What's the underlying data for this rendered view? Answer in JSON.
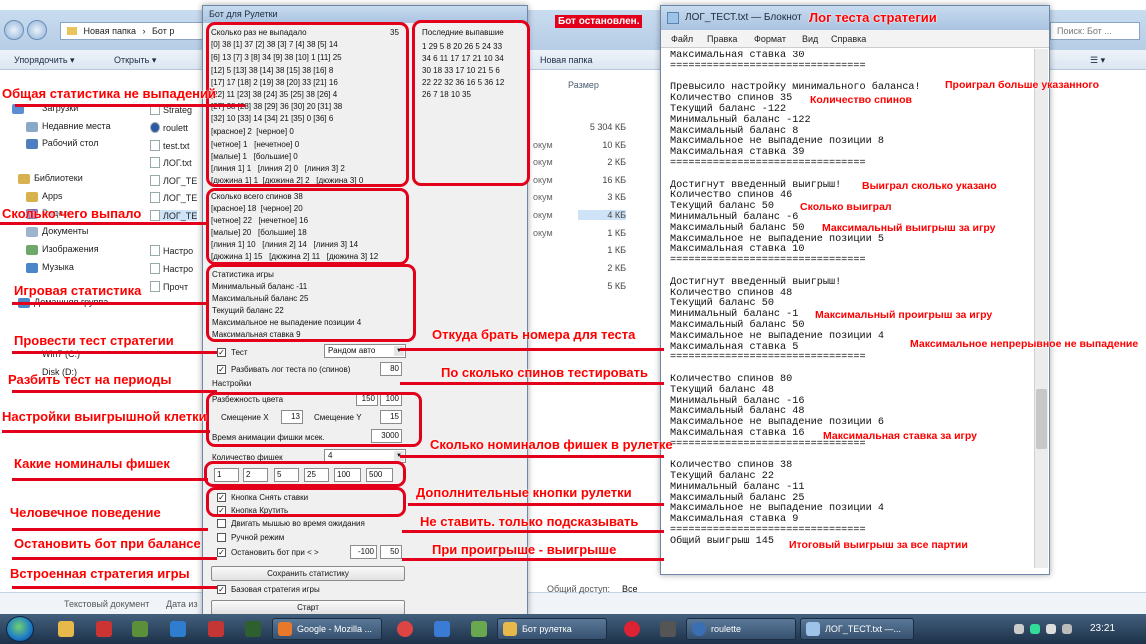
{
  "explorer": {
    "address": [
      "Новая папка",
      "Бот р"
    ],
    "search_placeholder": "Поиск: Бот ...",
    "toolbar": {
      "organize": "Упорядочить ▾",
      "open": "Открыть ▾",
      "new_folder": "Новая папка"
    },
    "size_header": "Размер",
    "sidebar": [
      "Загрузки",
      "Недавние места",
      "Рабочий стол",
      "Библиотеки",
      "Apps",
      "Видео",
      "Документы",
      "Изображения",
      "Музыка",
      "Домашняя группа",
      "Win7 (C:)",
      "Disk (D:)"
    ],
    "files": [
      "Strateg",
      "roulett",
      "test.txt",
      "ЛОГ.txt",
      "ЛОГ_ТЕ",
      "ЛОГ_ТЕ",
      "ЛОГ_ТЕ",
      "Настро",
      "Настро",
      "Прочт"
    ],
    "file_kinds": [
      "",
      "",
      "окум",
      "окум",
      "окум",
      "окум",
      "окум",
      "окум",
      "",
      ""
    ],
    "sizes": [
      "5 304 КБ",
      "10 КБ",
      "2 КБ",
      "16 КБ",
      "3 КБ",
      "4 КБ",
      "1 КБ",
      "1 КБ",
      "2 КБ",
      "5 КБ"
    ],
    "status_doc": "Текстовый документ",
    "status_date": "Дата из",
    "status_access": "Общий доступ:",
    "status_access_value": "Все"
  },
  "bot": {
    "title": "Бот для Рулетки",
    "never_header": "Сколько раз не выпадало",
    "never_max": "35",
    "never_lines": [
      "[0] 38 [1] 37 [2] 38 [3] 7 [4] 38 [5] 14",
      "[6] 13 [7] 3 [8] 34 [9] 38 [10] 1 [11] 25",
      "[12] 5 [13] 38 [14] 38 [15] 38 [16] 8",
      "[17] 17 [18] 2 [19] 38 [20] 33 [21] 16",
      "[22] 11 [23] 38 [24] 35 [25] 38 [26] 4",
      "[27] 38 [28] 38 [29] 36 [30] 20 [31] 38",
      "[32] 10 [33] 14 [34] 21 [35] 0 [36] 6",
      "[красное] 2  [черное] 0",
      "[четное] 1   [нечетное] 0",
      "[малые] 1   [большие] 0",
      "[линия 1] 1   [линия 2] 0   [линия 3] 2",
      "[дюжина 1] 1  [дюжина 2] 2   [дюжина 3] 0"
    ],
    "last_header": "Последние выпавшие",
    "last_lines": [
      "1 29 5 8 20 26 5 24 33",
      "34 6 11 17 17 21 10 34",
      "30 18 33 17 10 21 5 6",
      "22 22 32 36 16 5 36 12",
      "26 7 18 10 35"
    ],
    "total_header": "Сколько всего спинов 38",
    "total_lines": [
      "[красное] 18  [черное] 20",
      "[четное] 22   [нечетное] 16",
      "[малые] 20   [большие] 18",
      "[линия 1] 10   [линия 2] 14   [линия 3] 14",
      "[дюжина 1] 15   [дюжина 2] 11   [дюжина 3] 12"
    ],
    "game_stats_lines": [
      "Статистика игры",
      "Минимальный баланс -11",
      "Максимальный баланс 25",
      "Текущий баланс 22",
      "Максимальное не выпадение позиции 4",
      "Максимальная ставка 9"
    ],
    "test_label": "Тест",
    "test_source": "Рандом авто",
    "split_label": "Разбивать лог теста по (спинов)",
    "split_value": "80",
    "settings_label": "Настройки",
    "color_spread_label": "Разбежность цвета",
    "color_spread_values": [
      "150",
      "100"
    ],
    "offset_x_label": "Смещение X",
    "offset_x_value": "13",
    "offset_y_label": "Смещение Y",
    "offset_y_value": "15",
    "anim_label": "Время анимации фишки мсек.",
    "anim_value": "3000",
    "chips_count_label": "Количество фишек",
    "chips_count_value": "4",
    "chip_values": [
      "1",
      "2",
      "5",
      "25",
      "100",
      "500"
    ],
    "clear_bets_label": "Кнопка Снять ставки",
    "spin_label": "Кнопка Крутить",
    "move_mouse_label": "Двигать мышью во время ожидания",
    "manual_label": "Ручной режим",
    "stop_label": "Остановить бот при < >",
    "stop_min": "-100",
    "stop_max": "50",
    "save_stats_btn": "Сохранить статистику",
    "base_strategy_label": "Базовая стратегия игры",
    "start_btn": "Старт"
  },
  "notepad": {
    "title": "ЛОГ_ТЕСТ.txt — Блокнот",
    "menu": [
      "Файл",
      "Правка",
      "Формат",
      "Вид",
      "Справка"
    ],
    "lines": [
      "Максимальная ставка 30",
      "================================",
      "",
      "Превысило настройку минимального баланса!",
      "Количество спинов 35",
      "Текущий баланс -122",
      "Минимальный баланс -122",
      "Максимальный баланс 8",
      "Максимальное не выпадение позиции 8",
      "Максимальная ставка 39",
      "================================",
      "",
      "Достигнут введенный выигрыш!",
      "Количество спинов 46",
      "Текущий баланс 50",
      "Минимальный баланс -6",
      "Максимальный баланс 50",
      "Максимальное не выпадение позиции 5",
      "Максимальная ставка 10",
      "================================",
      "",
      "Достигнут введенный выигрыш!",
      "Количество спинов 48",
      "Текущий баланс 50",
      "Минимальный баланс -1",
      "Максимальный баланс 50",
      "Максимальное не выпадение позиции 4",
      "Максимальная ставка 5",
      "================================",
      "",
      "Количество спинов 80",
      "Текущий баланс 48",
      "Минимальный баланс -16",
      "Максимальный баланс 48",
      "Максимальное не выпадение позиции 6",
      "Максимальная ставка 16",
      "================================",
      "",
      "Количество спинов 38",
      "Текущий баланс 22",
      "Минимальный баланс -11",
      "Максимальный баланс 25",
      "Максимальное не выпадение позиции 4",
      "Максимальная ставка 9",
      "================================",
      "Общий выигрыш 145"
    ]
  },
  "annotations": {
    "bot_stopped": "Бот остановлен.",
    "log_title": "Лог теста стратегии",
    "general_stats": "Общая статистика не выпадений",
    "what_fell": "Сколько чего выпало",
    "game_stats": "Игровая статистика",
    "run_test": "Провести тест стратегии",
    "split_periods": "Разбить тест на периоды",
    "win_cell_settings": "Настройки выигрышной клетки",
    "chip_values": "Какие номиналы фишек",
    "human_behavior": "Человечное поведение",
    "stop_on_balance": "Остановить бот при балансе",
    "builtin_strategy": "Встроенная стратегия игры",
    "numbers_source": "Откуда брать номера для теста",
    "spins_per_test": "По сколько спинов тестировать",
    "chips_in_roulette": "Сколько номиналов фишек в рулетке",
    "extra_buttons": "Дополнительные кнопки рулетки",
    "advise_only": "Не ставить. только подсказывать",
    "loss_win": "При проигрыше - выигрыше",
    "lost_more": "Проиграл больше указанного",
    "spin_count": "Количество спинов",
    "won_as_set": "Выиграл сколько указано",
    "how_much_won": "Сколько выиграл",
    "max_win": "Максимальный выигрыш за игру",
    "max_loss": "Максимальный проигрыш за игру",
    "max_gap": "Максимальное непрерывное не выпадение",
    "max_bet": "Максимальная ставка за игру",
    "total_win": "Итоговый выигрыш за все партии"
  },
  "taskbar": {
    "tasks": [
      "Google - Mozilla ...",
      "Бот рулетка",
      "roulette",
      "ЛОГ_ТЕСТ.txt —..."
    ],
    "clock": "23:21"
  }
}
